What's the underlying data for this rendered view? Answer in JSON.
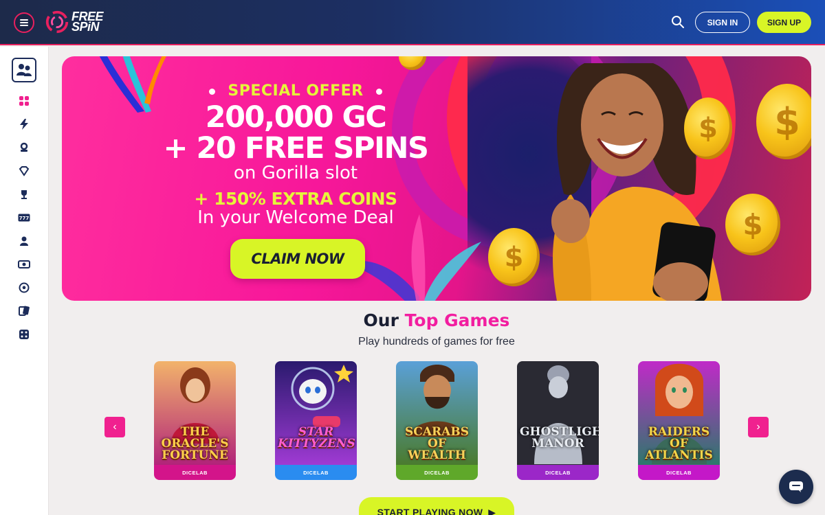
{
  "header": {
    "logo_line1": "FREE",
    "logo_line2": "SPiN",
    "signin_label": "SIGN IN",
    "signup_label": "SIGN UP"
  },
  "sidebar": {
    "items": [
      {
        "icon": "grid-icon"
      },
      {
        "icon": "lightning-icon"
      },
      {
        "icon": "slot-icon"
      },
      {
        "icon": "diamond-icon"
      },
      {
        "icon": "trophy-icon"
      },
      {
        "icon": "777-icon"
      },
      {
        "icon": "person-icon"
      },
      {
        "icon": "ticket-icon"
      },
      {
        "icon": "ball-icon"
      },
      {
        "icon": "cards-icon"
      },
      {
        "icon": "dice-icon"
      }
    ]
  },
  "banner": {
    "special": "SPECIAL OFFER",
    "line1": "200,000 GC",
    "line2": "+ 20 FREE SPINS",
    "slot": "on Gorilla slot",
    "extra": "+ 150% EXTRA COINS",
    "welcome": "In your Welcome Deal",
    "cta": "CLAIM NOW"
  },
  "top_games": {
    "title_plain": "Our",
    "title_accent": "Top Games",
    "subtitle": "Play hundreds of games for free",
    "games": [
      {
        "name": "THE ORACLE'S FORTUNE",
        "provider": "DICELAB"
      },
      {
        "name": "STAR KITTYZENS",
        "provider": "DICELAB"
      },
      {
        "name": "SCARABS OF WEALTH",
        "provider": "DICELAB"
      },
      {
        "name": "GHOSTLIGHT MANOR",
        "provider": "DICELAB"
      },
      {
        "name": "RAIDERS OF ATLANTIS",
        "provider": "DICELAB"
      }
    ],
    "cta": "START PLAYING NOW"
  },
  "colors": {
    "accent_pink": "#f21ea0",
    "accent_lime": "#d8f526",
    "navy": "#1c2c4e"
  }
}
